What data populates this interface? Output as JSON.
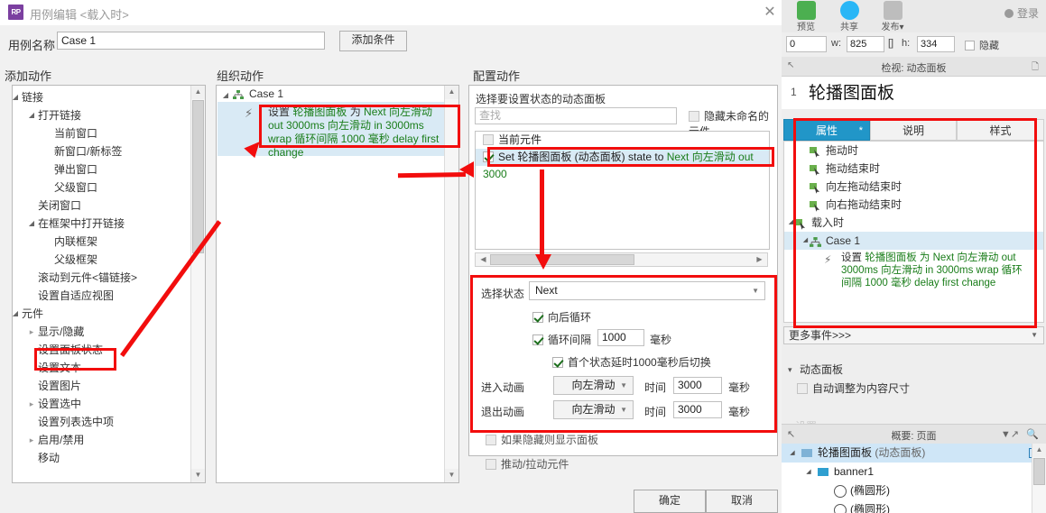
{
  "dialog": {
    "title": "用例编辑 <载入时>",
    "app_icon": "RP",
    "close_icon": "close-icon",
    "case_name_label": "用例名称",
    "case_name_value": "Case 1",
    "add_condition_button": "添加条件",
    "columns": {
      "add_action": "添加动作",
      "organize_action": "组织动作",
      "configure_action": "配置动作"
    },
    "ok_button": "确定",
    "cancel_button": "取消"
  },
  "action_tree": [
    {
      "label": "链接",
      "depth": 0,
      "toggle": "open"
    },
    {
      "label": "打开链接",
      "depth": 1,
      "toggle": "open"
    },
    {
      "label": "当前窗口",
      "depth": 2,
      "toggle": "none"
    },
    {
      "label": "新窗口/新标签",
      "depth": 2,
      "toggle": "none"
    },
    {
      "label": "弹出窗口",
      "depth": 2,
      "toggle": "none"
    },
    {
      "label": "父级窗口",
      "depth": 2,
      "toggle": "none"
    },
    {
      "label": "关闭窗口",
      "depth": 1,
      "toggle": "none"
    },
    {
      "label": "在框架中打开链接",
      "depth": 1,
      "toggle": "open"
    },
    {
      "label": "内联框架",
      "depth": 2,
      "toggle": "none"
    },
    {
      "label": "父级框架",
      "depth": 2,
      "toggle": "none"
    },
    {
      "label": "滚动到元件<锚链接>",
      "depth": 1,
      "toggle": "none"
    },
    {
      "label": "设置自适应视图",
      "depth": 1,
      "toggle": "none"
    },
    {
      "label": "元件",
      "depth": 0,
      "toggle": "open"
    },
    {
      "label": "显示/隐藏",
      "depth": 1,
      "toggle": "closed"
    },
    {
      "label": "设置面板状态",
      "depth": 1,
      "toggle": "none",
      "highlighted": true
    },
    {
      "label": "设置文本",
      "depth": 1,
      "toggle": "none"
    },
    {
      "label": "设置图片",
      "depth": 1,
      "toggle": "none"
    },
    {
      "label": "设置选中",
      "depth": 1,
      "toggle": "closed"
    },
    {
      "label": "设置列表选中项",
      "depth": 1,
      "toggle": "none"
    },
    {
      "label": "启用/禁用",
      "depth": 1,
      "toggle": "closed"
    },
    {
      "label": "移动",
      "depth": 1,
      "toggle": "none"
    }
  ],
  "organize": {
    "case_label": "Case 1",
    "action_segments": [
      {
        "text": "设置 ",
        "kind": "plain"
      },
      {
        "text": "轮播图面板",
        "kind": "green"
      },
      {
        "text": " 为 ",
        "kind": "plain"
      },
      {
        "text": "Next 向左滑动 out 3000ms 向左滑动 in 3000ms wrap 循环间隔 1000 毫秒 delay first change",
        "kind": "green"
      }
    ],
    "action_plain_text": "设置 轮播图面板 为 Next 向左滑动 out 3000ms 向左滑动 in 3000ms wrap 循环间隔 1000 毫秒 delay first change"
  },
  "configure": {
    "select_panel_label": "选择要设置状态的动态面板",
    "search_placeholder": "查找",
    "hide_unnamed_label": "隐藏未命名的元件",
    "hide_unnamed_checked": false,
    "items": [
      {
        "label": "当前元件",
        "checked": false,
        "selected": false
      },
      {
        "label": "Set 轮播图面板 (动态面板) state to Next 向左滑动 out 3000",
        "checked": true,
        "selected": true
      }
    ],
    "state_label": "选择状态",
    "state_value": "Next",
    "loop_back_label": "向后循环",
    "loop_back_checked": true,
    "loop_interval_label": "循环间隔",
    "loop_interval_value": "1000",
    "loop_interval_unit": "毫秒",
    "loop_interval_checked": true,
    "first_delay_label": "首个状态延时1000毫秒后切换",
    "first_delay_checked": true,
    "enter_anim_label": "进入动画",
    "enter_anim_value": "向左滑动",
    "enter_time_label": "时间",
    "enter_time_value": "3000",
    "enter_time_unit": "毫秒",
    "exit_anim_label": "退出动画",
    "exit_anim_value": "向左滑动",
    "exit_time_label": "时间",
    "exit_time_value": "3000",
    "exit_time_unit": "毫秒",
    "show_if_hidden_label": "如果隐藏则显示面板",
    "show_if_hidden_checked": false,
    "push_pull_label": "推动/拉动元件",
    "push_pull_checked": false
  },
  "sidebar": {
    "toolbar": [
      {
        "label": "预览",
        "icon": "preview-icon",
        "color": "#4caf50"
      },
      {
        "label": "共享",
        "icon": "share-icon",
        "color": "#29b6f6"
      },
      {
        "label": "发布▾",
        "icon": "publish-icon",
        "color": "#b8b8b8"
      }
    ],
    "login_label": "登录",
    "prop_bar": {
      "x_value": "0",
      "w_label": "w:",
      "w_value": "825",
      "h_label": "h:",
      "h_value": "334",
      "hidden_label": "隐藏",
      "hidden_checked": false
    },
    "inspector_title": "检视: 动态面板",
    "widget_index": "1",
    "widget_name": "轮播图面板",
    "tabs": [
      {
        "label": "属性",
        "active": true,
        "star": "*"
      },
      {
        "label": "说明",
        "active": false
      },
      {
        "label": "样式",
        "active": false
      }
    ],
    "events": [
      {
        "label": "拖动时",
        "depth": 1,
        "toggle": "none"
      },
      {
        "label": "拖动结束时",
        "depth": 1,
        "toggle": "none"
      },
      {
        "label": "向左拖动结束时",
        "depth": 1,
        "toggle": "none"
      },
      {
        "label": "向右拖动结束时",
        "depth": 1,
        "toggle": "none"
      },
      {
        "label": "载入时",
        "depth": 0,
        "toggle": "open"
      },
      {
        "label": "Case 1",
        "depth": 1,
        "toggle": "open",
        "selected": true
      }
    ],
    "event_action_text": "设置 轮播图面板 为 Next 向左滑动 out 3000ms 向左滑动 in 3000ms wrap 循环间隔 1000 毫秒 delay first change",
    "more_events_label": "更多事件>>>",
    "dynamic_panel_section": "动态面板",
    "auto_fit_label": "自动调整为内容尺寸",
    "auto_fit_checked": false,
    "overview_title": "概要: 页面",
    "overview_tree": [
      {
        "label": "轮播图面板",
        "suffix": "(动态面板)",
        "depth": 0,
        "icon": "panel-icon",
        "selected": true,
        "toggle": "open",
        "eye": true
      },
      {
        "label": "banner1",
        "suffix": "",
        "depth": 1,
        "icon": "rect-icon",
        "selected": false,
        "toggle": "open"
      },
      {
        "label": "(椭圆形)",
        "suffix": "",
        "depth": 2,
        "icon": "ellipse-icon",
        "selected": false,
        "toggle": "none"
      },
      {
        "label": "(椭圆形)",
        "suffix": "",
        "depth": 2,
        "icon": "ellipse-icon",
        "selected": false,
        "toggle": "none"
      }
    ]
  },
  "annotation": {
    "color": "#f20d0d"
  }
}
